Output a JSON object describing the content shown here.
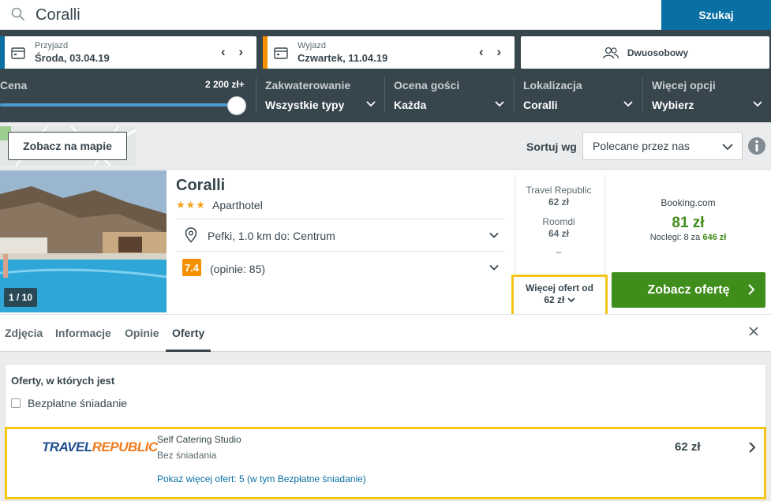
{
  "search": {
    "query": "Coralli",
    "button": "Szukaj"
  },
  "dates": {
    "checkin": {
      "label": "Przyjazd",
      "value": "Środa, 03.04.19",
      "color": "#0a6fa3"
    },
    "checkout": {
      "label": "Wyjazd",
      "value": "Czwartek, 11.04.19",
      "color": "#f48f00"
    },
    "nav": "‹ ›",
    "room": "Dwuosobowy"
  },
  "filters": {
    "price": {
      "title": "Cena",
      "max": "2 200 zł+",
      "fraction": 1.0
    },
    "accommodation": {
      "title": "Zakwaterowanie",
      "value": "Wszystkie typy"
    },
    "rating": {
      "title": "Ocena gości",
      "value": "Każda"
    },
    "location": {
      "title": "Lokalizacja",
      "value": "Coralli"
    },
    "more": {
      "title": "Więcej opcji",
      "value": "Wybierz"
    }
  },
  "toolbar": {
    "map_button": "Zobacz na mapie",
    "sort_label": "Sortuj wg",
    "sort_value": "Polecane przez nas"
  },
  "hotel": {
    "name": "Coralli",
    "stars": "★★★",
    "type": "Aparthotel",
    "photo_count": "1 / 10",
    "location": "Pefki, 1.0 km do: Centrum",
    "rating": "7.4",
    "reviews": "(opinie: 85)",
    "partners": [
      {
        "name": "Travel Republic",
        "price": "62 zł"
      },
      {
        "name": "Roomdi",
        "price": "64 zł"
      }
    ],
    "dash": "–",
    "more_offers_line1": "Więcej ofert od",
    "more_offers_line2": "62 zł",
    "best": {
      "name": "Booking.com",
      "price": "81 zł",
      "nights_prefix": "Noclegi: 8 za",
      "nights_total": "646 zł"
    },
    "cta": "Zobacz ofertę"
  },
  "tabs": [
    {
      "label": "Zdjęcia"
    },
    {
      "label": "Informacje"
    },
    {
      "label": "Opinie"
    },
    {
      "label": "Oferty"
    }
  ],
  "offers": {
    "title": "Oferty, w których jest",
    "filter_label": "Bezpłatne śniadanie",
    "row": {
      "logo_part1": "TRAVEL",
      "logo_part2": "REPUBLIC",
      "room": "Self Catering Studio",
      "board": "Bez śniadania",
      "more": "Pokaż więcej ofert: 5 (w tym Bezpłatne śniadanie)",
      "price": "62 zł"
    }
  },
  "colors": {
    "accent": "#0a6fa3",
    "band": "#37454d",
    "green": "#3f8d1b",
    "highlight": "#f5c518",
    "rating": "#f48f00"
  }
}
